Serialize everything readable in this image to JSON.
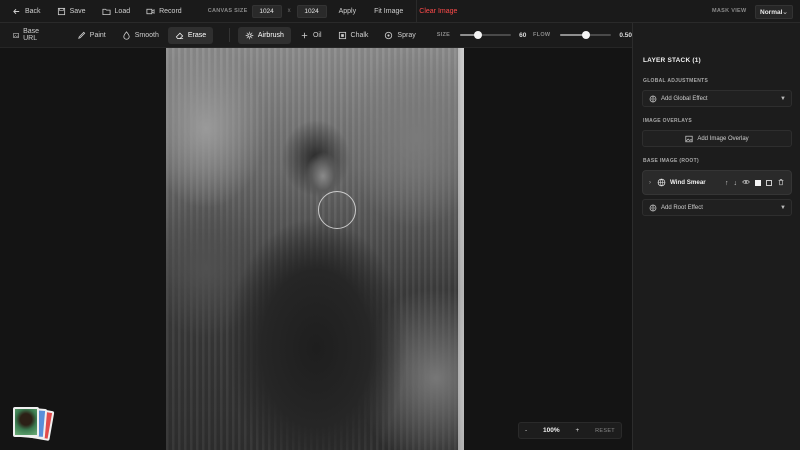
{
  "topbar": {
    "back": "Back",
    "save": "Save",
    "load": "Load",
    "record": "Record",
    "canvas_size_label": "CANVAS SIZE",
    "width": "1024",
    "height": "1024",
    "times": "x",
    "apply": "Apply",
    "fit_image": "Fit Image",
    "clear_image": "Clear Image",
    "mask_view_label": "MASK VIEW",
    "mask_view_value": "Normal"
  },
  "tools": {
    "base_url": "Base URL",
    "paint": "Paint",
    "smooth": "Smooth",
    "erase": "Erase",
    "airbrush": "Airbrush",
    "oil": "Oil",
    "chalk": "Chalk",
    "spray": "Spray",
    "size_label": "SIZE",
    "size_value": "60",
    "size_fraction": 0.35,
    "flow_label": "FLOW",
    "flow_value": "0.50",
    "flow_fraction": 0.5
  },
  "zoom": {
    "minus": "-",
    "value": "100%",
    "plus": "+",
    "reset": "RESET"
  },
  "panel": {
    "title": "LAYER STACK (1)",
    "global_adjustments": "GLOBAL ADJUSTMENTS",
    "add_global_effect": "Add Global Effect",
    "image_overlays": "IMAGE OVERLAYS",
    "add_image_overlay": "Add Image Overlay",
    "base_image": "BASE IMAGE (ROOT)",
    "layer_name": "Wind Smear",
    "add_root_effect": "Add Root Effect"
  },
  "colors": {
    "clear_image": "#ff4a4a",
    "active_tool_bg": "#2f2f2f"
  }
}
